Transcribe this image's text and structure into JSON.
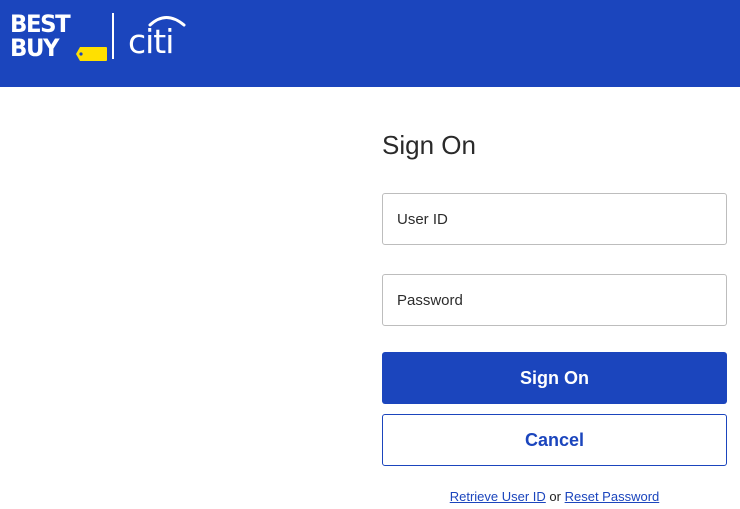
{
  "header": {
    "brand_line1": "BEST",
    "brand_line2": "BUY",
    "partner_logo_text": "citi",
    "background_color": "#1b45bd",
    "tag_color": "#ffe000"
  },
  "form": {
    "title": "Sign On",
    "user_id_placeholder": "User ID",
    "password_placeholder": "Password",
    "sign_on_label": "Sign On",
    "cancel_label": "Cancel"
  },
  "links": {
    "retrieve_user_id": "Retrieve User ID",
    "separator": "or",
    "reset_password": "Reset Password"
  },
  "colors": {
    "accent": "#1b45bd",
    "field_border": "#bdbdbd",
    "text": "#2a2a2a"
  }
}
